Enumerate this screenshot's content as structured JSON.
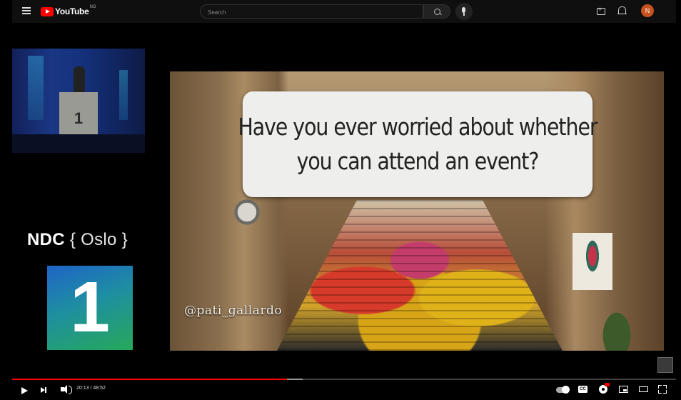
{
  "header": {
    "logo_text": "YouTube",
    "logo_region": "NO",
    "search_placeholder": "Search",
    "avatar_initial": "N"
  },
  "video": {
    "slide_text_line1": "Have you ever worried about whether",
    "slide_text_line2": "you can attend an event?",
    "photo_credit": "@pati_gallardo",
    "podium_number": "1",
    "conference_name": "NDC",
    "conference_city_brace": "{ Oslo }",
    "conference_logo_number": "1"
  },
  "player": {
    "time_display": "20:13 / 48:52",
    "progress_fraction": 0.414,
    "buffer_fraction": 0.438,
    "cc_label": "CC",
    "accent_color": "#ff0000"
  }
}
